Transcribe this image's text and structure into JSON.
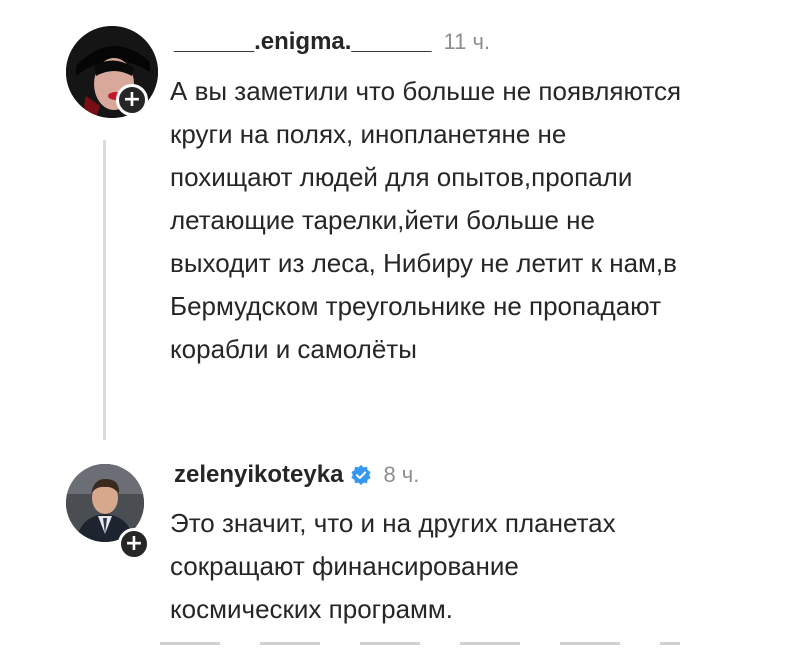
{
  "comments": [
    {
      "username": "______.enigma.______",
      "time": "11 ч.",
      "text": "А вы заметили что больше не появляются\nкруги на полях, инопланетяне не\nпохищают людей для опытов,пропали\nлетающие тарелки,йети больше не\nвыходит из леса, Нибиру не летит к нам,в\nБермудском треугольнике не пропадают\nкорабли и самолёты",
      "add_icon": "+",
      "avatar_icon": "avatar-woman-red-lips"
    },
    {
      "username": "zelenyikoteyka",
      "verified": true,
      "time": "8 ч.",
      "text": "Это значит, что и на других планетах\nсокращают финансирование\nкосмических программ.",
      "add_icon": "+",
      "avatar_icon": "avatar-man-in-suit"
    }
  ],
  "colors": {
    "text": "#262626",
    "secondary": "#8e8e8e",
    "verified": "#3897f0",
    "thread_line": "#dbdbdb"
  }
}
